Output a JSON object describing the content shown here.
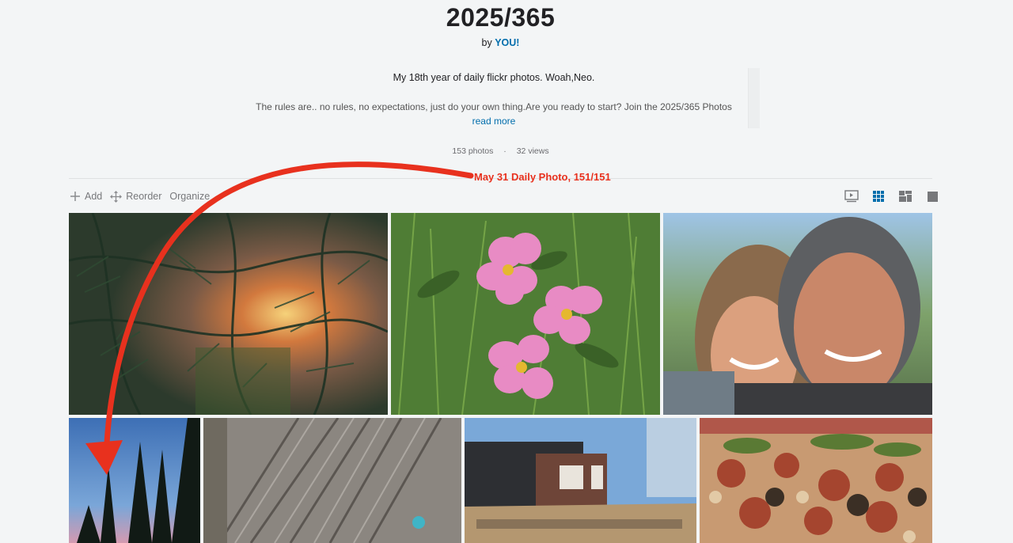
{
  "album": {
    "title": "2025/365",
    "by_prefix": "by",
    "owner": "YOU!",
    "description_line1": "My 18th year of daily flickr photos. Woah,Neo.",
    "description_line2": "The rules are.. no rules, no expectations, just do your own thing.Are you ready to start? Join the 2025/365 Photos",
    "read_more": "read more",
    "photo_count": "153 photos",
    "separator": "·",
    "view_count": "32 views"
  },
  "toolbar": {
    "add_label": "Add",
    "reorder_label": "Reorder",
    "organize_label": "Organize"
  },
  "view_modes": [
    {
      "icon": "slideshow-icon",
      "selected": false
    },
    {
      "icon": "grid-icon",
      "selected": true
    },
    {
      "icon": "mosaic-icon",
      "selected": false
    },
    {
      "icon": "single-view-icon",
      "selected": false
    }
  ],
  "annotation": {
    "text": "May 31 Daily Photo, 151/151",
    "color": "#e8311e"
  },
  "photos": [
    {
      "subject": "fir branches with sunset"
    },
    {
      "subject": "pink wild roses"
    },
    {
      "subject": "couple selfie"
    },
    {
      "subject": "pine trees at dusk"
    },
    {
      "subject": "tree bark close-up"
    },
    {
      "subject": "building reflection on Purveyors sign"
    },
    {
      "subject": "pizza close-up"
    }
  ],
  "colors": {
    "link": "#006dac",
    "background": "#f3f5f6",
    "accent_selected": "#006dac"
  }
}
